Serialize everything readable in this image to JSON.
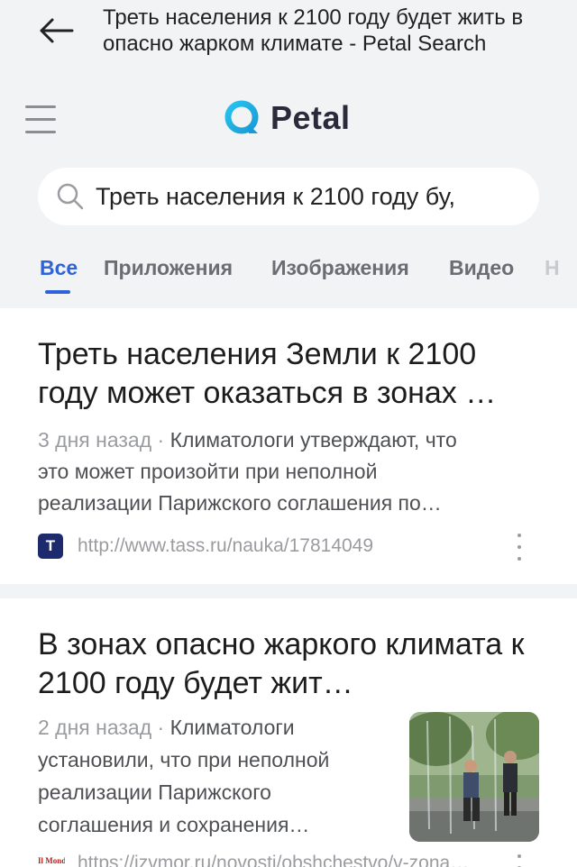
{
  "header": {
    "back_icon": "arrow-left-icon",
    "title": "Треть населения к 2100 году будет жить в опасно жарком климате - Petal Search"
  },
  "logo": {
    "text": "Petal",
    "icon": "petal-logo-icon",
    "brand_color": "#1fb8e6"
  },
  "search": {
    "value": "Треть населения к 2100 году бу,"
  },
  "tabs": [
    {
      "label": "Все",
      "active": true
    },
    {
      "label": "Приложения"
    },
    {
      "label": "Изображения"
    },
    {
      "label": "Видео"
    },
    {
      "label": "Н"
    }
  ],
  "results": [
    {
      "title": "Треть населения Земли к 2100 году может оказаться в зонах …",
      "date": "3 дня назад",
      "snippet_1": "Климатологи утверждают, что",
      "snippet_2": "это может произойти при неполной",
      "snippet_3": "реализации Парижского соглашения по…",
      "source_icon": "tass-favicon",
      "source_letter": "Т",
      "url": "http://www.tass.ru/nauka/17814049"
    },
    {
      "title": "В зонах опасно жаркого климата к 2100 году будет жит…",
      "date": "2 дня назад",
      "snippet_1": "Климатологи",
      "snippet_2": "установили, что при неполной",
      "snippet_3": "реализации Парижского",
      "snippet_4": "соглашения и сохранения…",
      "source_icon": "izvmor-favicon",
      "source_letter": "Il Monde",
      "url": "https://izvmor.ru/novosti/obshchestvo/v-zona…"
    }
  ],
  "colors": {
    "accent": "#2f64d8",
    "muted": "#9a9ca0",
    "background": "#f1f3f5"
  }
}
